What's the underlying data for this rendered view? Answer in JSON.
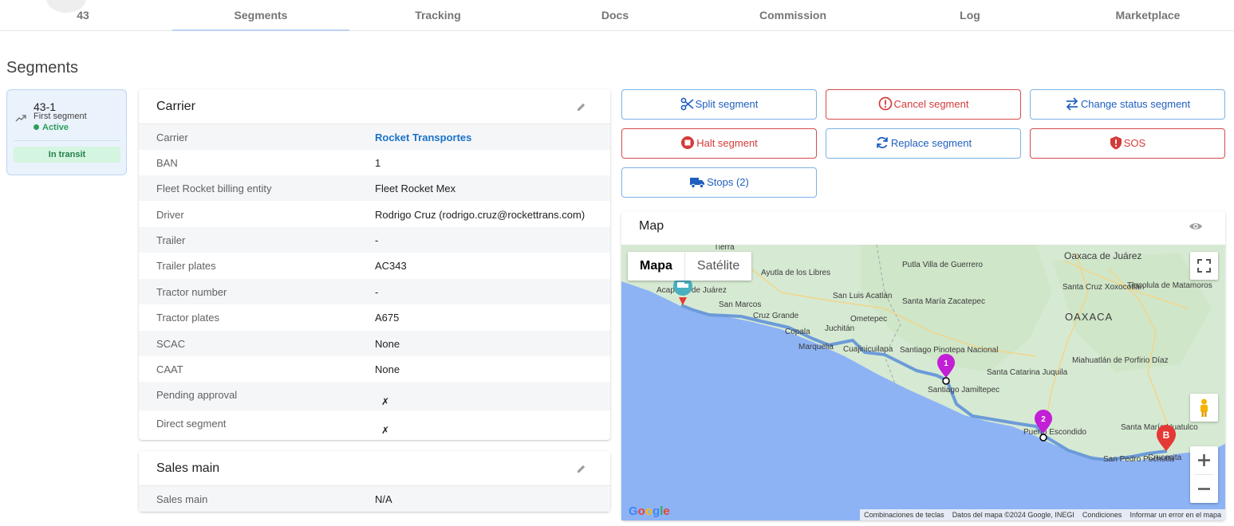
{
  "tabs": [
    {
      "label": "43"
    },
    {
      "label": "Segments"
    },
    {
      "label": "Tracking"
    },
    {
      "label": "Docs"
    },
    {
      "label": "Commission"
    },
    {
      "label": "Log"
    },
    {
      "label": "Marketplace"
    }
  ],
  "page_title": "Segments",
  "segment": {
    "id": "43-1",
    "subtitle": "First segment",
    "status": "Active",
    "badge": "In transit"
  },
  "carrier_panel": {
    "title": "Carrier",
    "rows": [
      {
        "label": "Carrier",
        "value": "Rocket Transportes"
      },
      {
        "label": "BAN",
        "value": "1"
      },
      {
        "label": "Fleet Rocket billing entity",
        "value": "Fleet Rocket Mex"
      },
      {
        "label": "Driver",
        "value": "Rodrigo Cruz (rodrigo.cruz@rockettrans.com)"
      },
      {
        "label": "Trailer",
        "value": "-"
      },
      {
        "label": "Trailer plates",
        "value": "AC343"
      },
      {
        "label": "Tractor number",
        "value": "-"
      },
      {
        "label": "Tractor plates",
        "value": "A675"
      },
      {
        "label": "SCAC",
        "value": "None"
      },
      {
        "label": "CAAT",
        "value": "None"
      },
      {
        "label": "Pending approval",
        "value": "✗"
      },
      {
        "label": "Direct segment",
        "value": "✗"
      }
    ]
  },
  "sales_panel": {
    "title": "Sales main",
    "rows": [
      {
        "label": "Sales main",
        "value": "N/A"
      }
    ]
  },
  "actions": {
    "split": "Split segment",
    "cancel": "Cancel segment",
    "change_status": "Change status segment",
    "halt": "Halt segment",
    "replace": "Replace segment",
    "sos": "SOS",
    "stops": "Stops (2)"
  },
  "map": {
    "title": "Map",
    "type_map": "Mapa",
    "type_satellite": "Satélite",
    "places": {
      "oaxaca_juarez": "Oaxaca de Juárez",
      "tierra": "Tierra",
      "ayutla": "Ayutla de los Libres",
      "putla": "Putla Villa de Guerrero",
      "santa_cruz_x": "Santa Cruz Xoxocotlán",
      "tlacolula": "Tlacolula de Matamoros",
      "acapulco": "Acapulco de Juárez",
      "san_marcos": "San Marcos",
      "san_luis": "San Luis Acatlán",
      "cruz_grande": "Cruz Grande",
      "santa_maria_z": "Santa María Zacatepec",
      "oaxaca_state": "OAXACA",
      "copala": "Copala",
      "juchitan": "Juchitán",
      "ometepec": "Ometepec",
      "marquelia": "Marquelia",
      "cuaji": "Cuajinicuilapa",
      "santiago_pn": "Santiago Pinotepa Nacional",
      "miahuatlan": "Miahuatlán de Porfirio Díaz",
      "santa_catarina": "Santa Catarina Juquila",
      "santiago_j": "Santiago Jamiltepec",
      "escondido": "Puerto Escondido",
      "santa_maria_h": "Santa María Huatulco",
      "san_pedro": "San Pedro Pochutla",
      "crucecita": "Crucecita"
    },
    "marker_1": "1",
    "marker_2": "2",
    "marker_b": "B",
    "google": "Google",
    "footer": [
      "Combinaciones de teclas",
      "Datos del mapa ©2024 Google, INEGI",
      "Condiciones",
      "Informar un error en el mapa"
    ]
  }
}
